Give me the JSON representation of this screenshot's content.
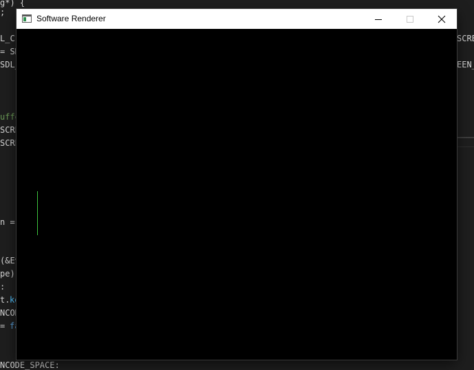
{
  "window": {
    "title": "Software Renderer",
    "controls": {
      "minimize": "minimize-icon",
      "maximize": "maximize-icon",
      "close": "close-icon"
    }
  },
  "canvas": {
    "background": "#000000",
    "line_color": "#3ec43e"
  },
  "editor": {
    "fragments": [
      {
        "text": "g*) {",
        "kind": "plain"
      },
      {
        "text": ";",
        "kind": "plain"
      },
      {
        "text": "L_C",
        "kind": "plain"
      },
      {
        "text": "= SD",
        "kind": "plain"
      },
      {
        "text": "SDL_",
        "kind": "plain"
      },
      {
        "text": "uffe",
        "kind": "comment"
      },
      {
        "text": "SCRE",
        "kind": "plain"
      },
      {
        "text": "SCRE",
        "kind": "plain"
      },
      {
        "text": "n =",
        "kind": "plain"
      },
      {
        "text": "(&Ev",
        "kind": "plain"
      },
      {
        "text": "pe)",
        "kind": "plain"
      },
      {
        "text": ":",
        "kind": "plain"
      },
      {
        "text": "t.",
        "kind": "plain"
      },
      {
        "text": "ke",
        "kind": "member"
      },
      {
        "text": "NCOD",
        "kind": "plain"
      },
      {
        "text": "= ",
        "kind": "plain"
      },
      {
        "text": "fa",
        "kind": "keyword"
      },
      {
        "text": "NCODE_SPACE:",
        "kind": "plain"
      },
      {
        "text": "SCRE",
        "kind": "plain"
      },
      {
        "text": "EEN_",
        "kind": "plain"
      }
    ]
  }
}
